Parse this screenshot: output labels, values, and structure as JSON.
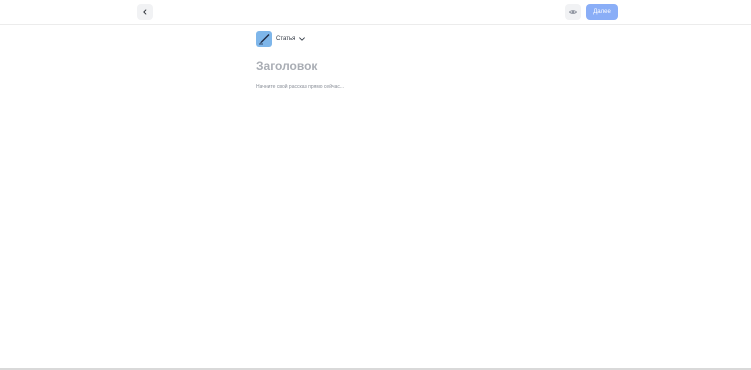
{
  "toolbar": {
    "next_label": "Далее",
    "next_button_color": "#8aaef7"
  },
  "editor": {
    "post_type_label": "Статья",
    "title_placeholder": "Заголовок",
    "body_placeholder": "Начните свой рассказ прямо сейчас..."
  },
  "icons": {
    "back": "chevron-left-icon",
    "preview": "eye-icon",
    "post_type": "pen-icon",
    "dropdown": "chevron-down-icon"
  }
}
